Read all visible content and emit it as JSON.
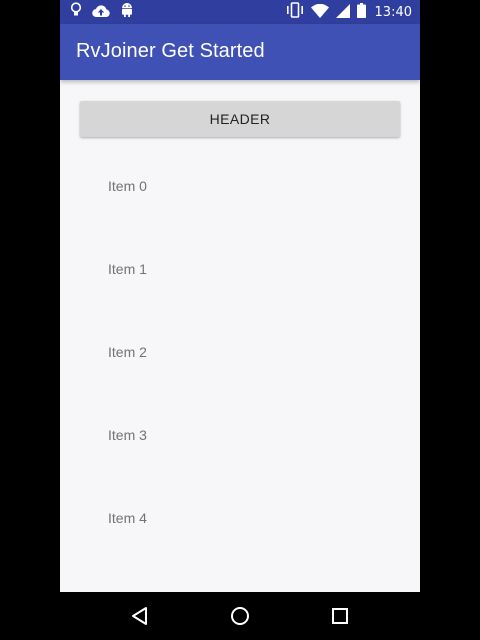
{
  "status_bar": {
    "time": "13:40",
    "left_icons": [
      "lightbulb-icon",
      "cloud-upload-icon",
      "android-icon"
    ],
    "right_icons": [
      "vibrate-icon",
      "wifi-icon",
      "signal-icon",
      "battery-icon"
    ]
  },
  "app_bar": {
    "title": "RvJoiner Get Started",
    "color": "#3f51b5",
    "status_color": "#303f9f"
  },
  "header_button": {
    "label": "HEADER"
  },
  "list": {
    "items": [
      {
        "label": "Item 0"
      },
      {
        "label": "Item 1"
      },
      {
        "label": "Item 2"
      },
      {
        "label": "Item 3"
      },
      {
        "label": "Item 4"
      }
    ]
  },
  "nav_bar": {
    "buttons": [
      "back-icon",
      "home-icon",
      "recents-icon"
    ]
  }
}
